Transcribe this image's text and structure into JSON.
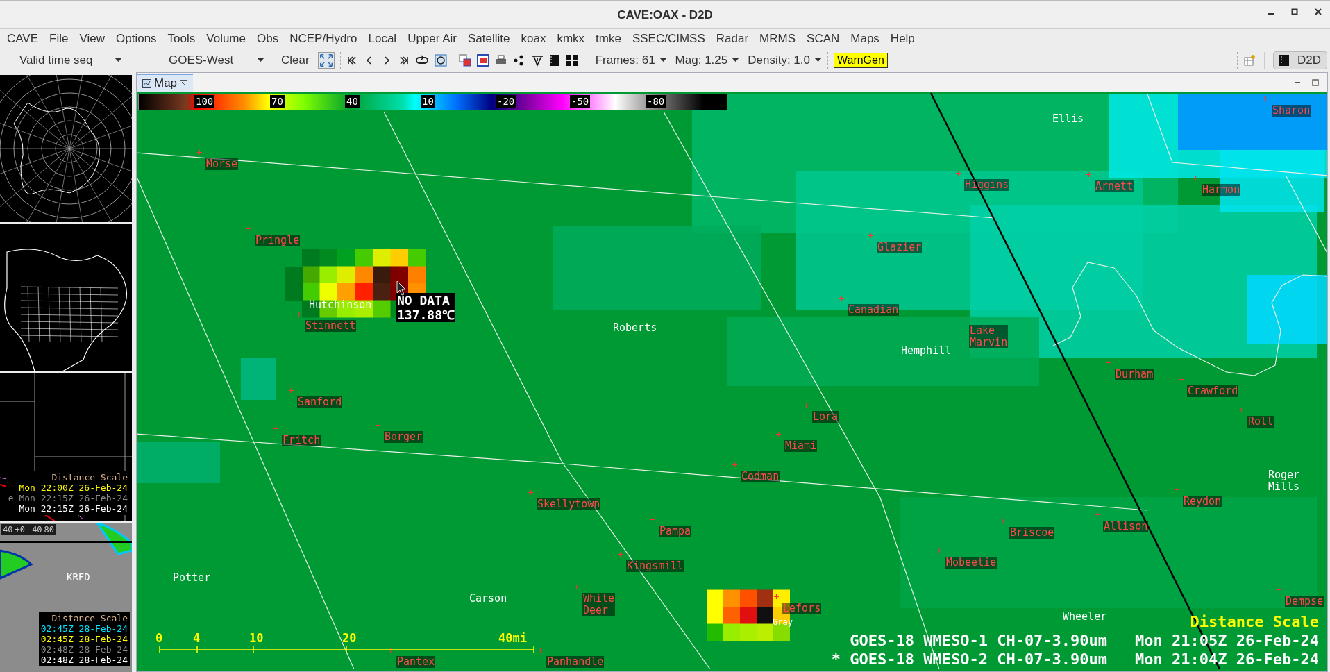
{
  "window": {
    "title": "CAVE:OAX - D2D"
  },
  "menu": [
    "CAVE",
    "File",
    "View",
    "Options",
    "Tools",
    "Volume",
    "Obs",
    "NCEP/Hydro",
    "Local",
    "Upper Air",
    "Satellite",
    "koax",
    "kmkx",
    "tmke",
    "SSEC/CIMSS",
    "Radar",
    "MRMS",
    "SCAN",
    "Maps",
    "Help"
  ],
  "toolbar": {
    "time_mode": "Valid time seq",
    "source": "GOES-West",
    "clear": "Clear",
    "frames": "Frames: 61",
    "mag": "Mag: 1.25",
    "density": "Density: 1.0",
    "warngen": "WarnGen",
    "perspective": "D2D"
  },
  "side_panes": [
    {
      "kind": "globe"
    },
    {
      "kind": "continent"
    },
    {
      "kind": "regional",
      "texts": [
        {
          "text": "Distance Scale",
          "color": "#d9b38c"
        },
        {
          "text": "Mon 22:00Z 26-Feb-24",
          "color": "#ffff00"
        },
        {
          "text": "e Mon 22:15Z 26-Feb-24",
          "color": "#8a8a8a"
        },
        {
          "text": "Mon 22:15Z 26-Feb-24",
          "color": "#ffffff"
        }
      ]
    },
    {
      "kind": "satellite",
      "colorbar": [
        "40",
        "+0-",
        "40",
        "80"
      ],
      "station": "KRFD",
      "texts": [
        {
          "text": "Distance Scale",
          "color": "#d9b38c"
        },
        {
          "text": "02:45Z 28-Feb-24",
          "color": "#00e5ff"
        },
        {
          "text": "02:45Z 28-Feb-24",
          "color": "#ffff00"
        },
        {
          "text": "02:48Z 28-Feb-24",
          "color": "#8a8a8a"
        },
        {
          "text": "02:48Z 28-Feb-24",
          "color": "#ffffff"
        }
      ]
    }
  ],
  "map": {
    "tab": {
      "label": "Map",
      "selected": true
    },
    "colorbar": [
      "100",
      "70",
      "40",
      "10",
      "-20",
      "-50",
      "-80"
    ],
    "places": [
      {
        "name": "Morse",
        "kind": "town"
      },
      {
        "name": "Pringle",
        "kind": "town"
      },
      {
        "name": "Hutchinson",
        "kind": "county"
      },
      {
        "name": "Stinnett",
        "kind": "town"
      },
      {
        "name": "Roberts",
        "kind": "county"
      },
      {
        "name": "Sanford",
        "kind": "town"
      },
      {
        "name": "Fritch",
        "kind": "town"
      },
      {
        "name": "Borger",
        "kind": "town"
      },
      {
        "name": "Skellytown",
        "kind": "town"
      },
      {
        "name": "Pampa",
        "kind": "town"
      },
      {
        "name": "Kingsmill",
        "kind": "town"
      },
      {
        "name": "Carson",
        "kind": "county"
      },
      {
        "name": "White\nDeer",
        "kind": "town"
      },
      {
        "name": "Potter",
        "kind": "county"
      },
      {
        "name": "Panhandle",
        "kind": "town"
      },
      {
        "name": "Pantex",
        "kind": "town"
      },
      {
        "name": "Ellis",
        "kind": "county"
      },
      {
        "name": "Higgins",
        "kind": "town"
      },
      {
        "name": "Arnett",
        "kind": "town"
      },
      {
        "name": "Harmon",
        "kind": "town"
      },
      {
        "name": "Sharon",
        "kind": "town"
      },
      {
        "name": "Glazier",
        "kind": "town"
      },
      {
        "name": "Canadian",
        "kind": "town"
      },
      {
        "name": "Lake\nMarvin",
        "kind": "town"
      },
      {
        "name": "Hemphill",
        "kind": "county"
      },
      {
        "name": "Durham",
        "kind": "town"
      },
      {
        "name": "Crawford",
        "kind": "town"
      },
      {
        "name": "Roll",
        "kind": "town"
      },
      {
        "name": "Lora",
        "kind": "town"
      },
      {
        "name": "Miami",
        "kind": "town"
      },
      {
        "name": "Codman",
        "kind": "town"
      },
      {
        "name": "Roger\nMills",
        "kind": "county"
      },
      {
        "name": "Reydon",
        "kind": "town"
      },
      {
        "name": "Briscoe",
        "kind": "town"
      },
      {
        "name": "Allison",
        "kind": "town"
      },
      {
        "name": "Mobeetie",
        "kind": "town"
      },
      {
        "name": "Lefors",
        "kind": "town"
      },
      {
        "name": "Gray",
        "kind": "county"
      },
      {
        "name": "Wheeler",
        "kind": "county"
      },
      {
        "name": "Dempse",
        "kind": "town"
      }
    ],
    "probe": [
      "NO DATA",
      "137.88℃"
    ],
    "scale_ticks": [
      "0",
      "4",
      "10",
      "20",
      "40mi"
    ],
    "scale_title": "Distance Scale",
    "legend": [
      {
        "product": "GOES-18 WMESO-1 CH-07-3.90um",
        "time": "Mon 21:05Z 26-Feb-24"
      },
      {
        "marker": "*",
        "product": "GOES-18 WMESO-2 CH-07-3.90um",
        "time": "Mon 21:04Z 26-Feb-24"
      }
    ]
  }
}
